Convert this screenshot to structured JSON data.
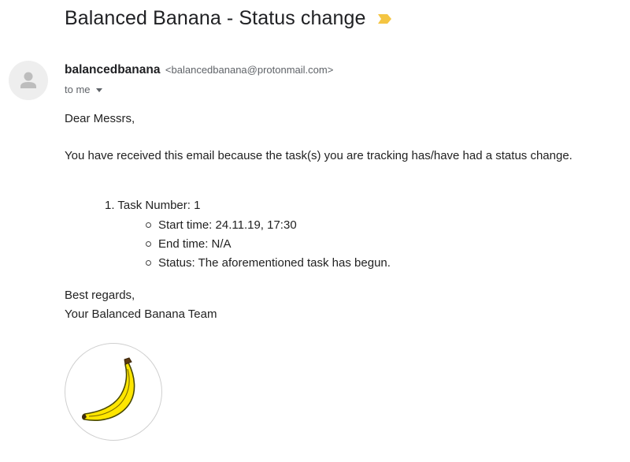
{
  "email": {
    "subject": "Balanced Banana - Status change",
    "importance_icon": "importance-marker-icon",
    "sender": {
      "name": "balancedbanana",
      "address": "<balancedbanana@protonmail.com>"
    },
    "recipient_label": "to me",
    "greeting": "Dear Messrs,",
    "intro": "You have received this email because the task(s) you are tracking has/have had a status change.",
    "task": {
      "title": "1. Task Number: 1",
      "details": [
        "Start time: 24.11.19, 17:30",
        "End time: N/A",
        "Status: The aforementioned task has begun."
      ]
    },
    "closing": "Best regards,",
    "signature": "Your Balanced Banana Team"
  },
  "colors": {
    "importance": "#f4c542",
    "banana": "#ffe600",
    "text": "#222222"
  }
}
